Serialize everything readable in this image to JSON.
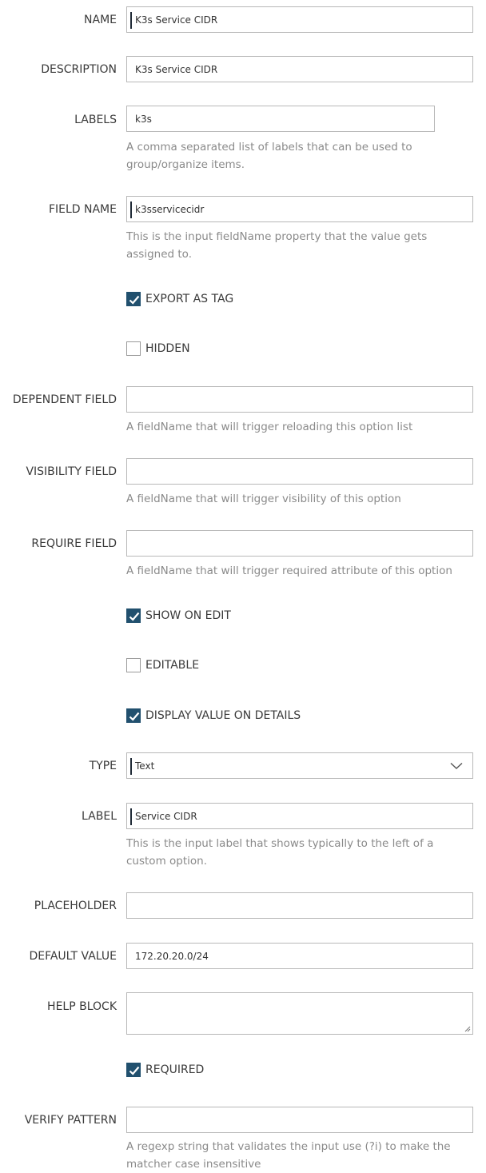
{
  "fields": {
    "name": {
      "label": "NAME",
      "value": "K3s Service CIDR"
    },
    "description": {
      "label": "DESCRIPTION",
      "value": "K3s Service CIDR"
    },
    "labels": {
      "label": "LABELS",
      "value": "k3s",
      "help": "A comma separated list of labels that can be used to group/organize items."
    },
    "field_name": {
      "label": "FIELD NAME",
      "value": "k3sservicecidr",
      "help": "This is the input fieldName property that the value gets assigned to."
    },
    "export_as_tag": {
      "label": "EXPORT AS TAG",
      "checked": true
    },
    "hidden": {
      "label": "HIDDEN",
      "checked": false
    },
    "dependent_field": {
      "label": "DEPENDENT FIELD",
      "value": "",
      "help": "A fieldName that will trigger reloading this option list"
    },
    "visibility_field": {
      "label": "VISIBILITY FIELD",
      "value": "",
      "help": "A fieldName that will trigger visibility of this option"
    },
    "require_field": {
      "label": "REQUIRE FIELD",
      "value": "",
      "help": "A fieldName that will trigger required attribute of this option"
    },
    "show_on_edit": {
      "label": "SHOW ON EDIT",
      "checked": true
    },
    "editable": {
      "label": "EDITABLE",
      "checked": false
    },
    "display_value_on_details": {
      "label": "DISPLAY VALUE ON DETAILS",
      "checked": true
    },
    "type": {
      "label": "TYPE",
      "value": "Text"
    },
    "label": {
      "label": "LABEL",
      "value": "Service CIDR",
      "help": "This is the input label that shows typically to the left of a custom option."
    },
    "placeholder": {
      "label": "PLACEHOLDER",
      "value": ""
    },
    "default_value": {
      "label": "DEFAULT VALUE",
      "value": "172.20.20.0/24"
    },
    "help_block": {
      "label": "HELP BLOCK",
      "value": ""
    },
    "required": {
      "label": "REQUIRED",
      "checked": true
    },
    "verify_pattern": {
      "label": "VERIFY PATTERN",
      "value": "",
      "help": "A regexp string that validates the input use (?i) to make the matcher case insensitive"
    }
  },
  "colors": {
    "checkbox_checked": "#21506e",
    "help_text": "#8a8a8a",
    "border": "#b8b8b8"
  }
}
